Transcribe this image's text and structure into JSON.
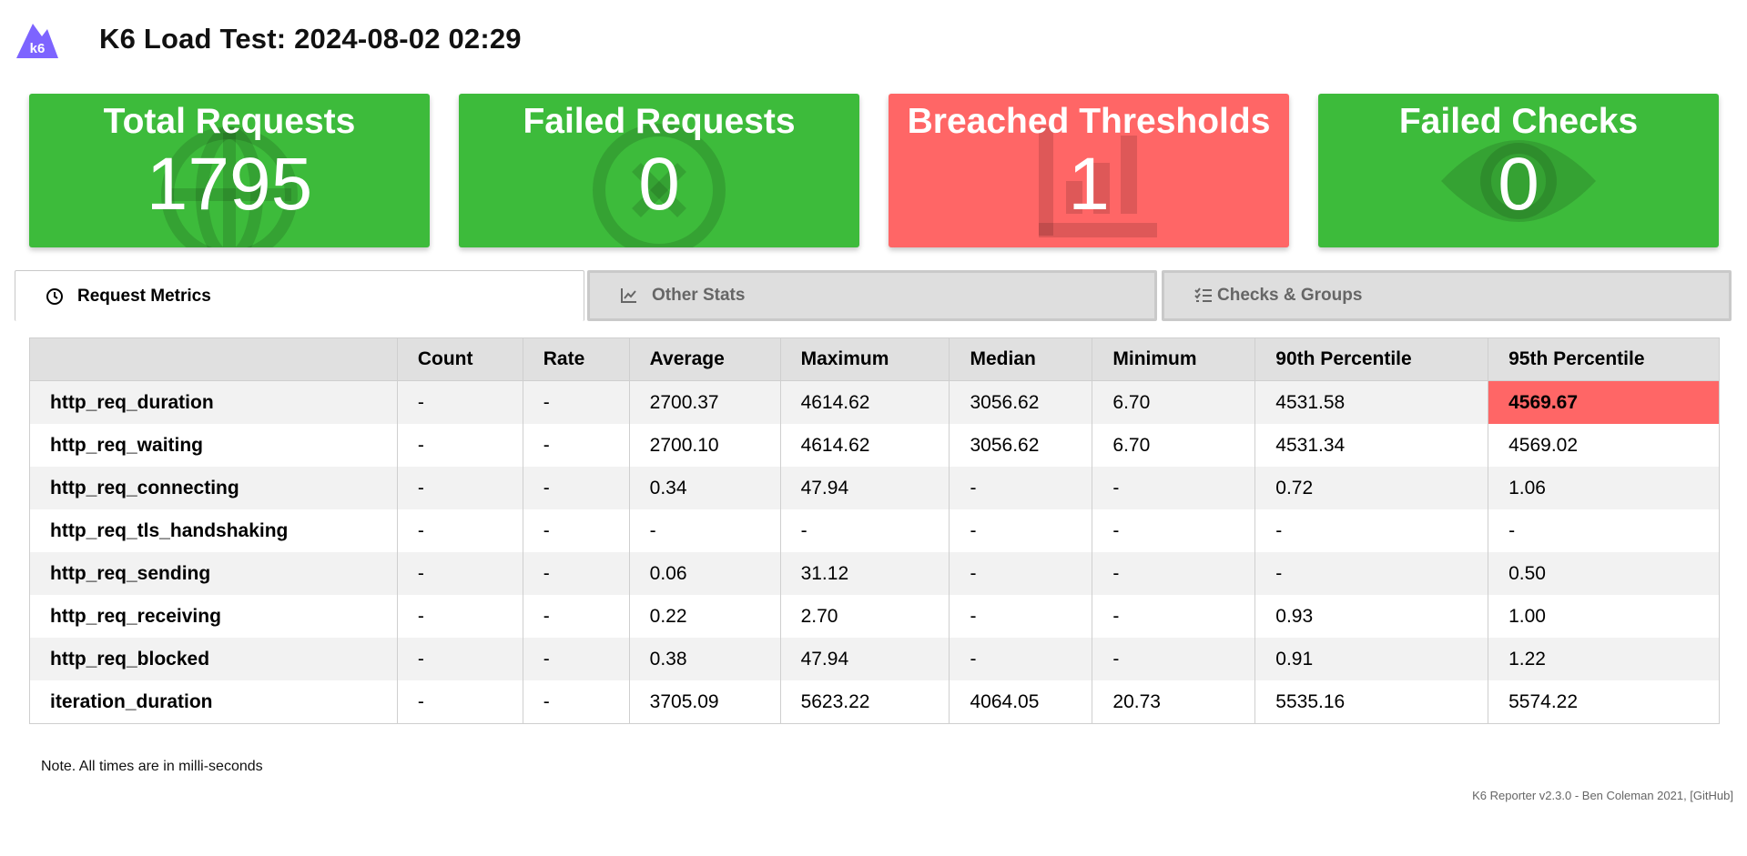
{
  "header": {
    "logo_text": "k6",
    "title": "K6 Load Test: 2024-08-02 02:29"
  },
  "cards": [
    {
      "label": "Total Requests",
      "value": "1795",
      "status": "ok",
      "color": "#3dbb3b",
      "icon": "globe-icon"
    },
    {
      "label": "Failed Requests",
      "value": "0",
      "status": "ok",
      "color": "#3dbb3b",
      "icon": "close-circle-icon"
    },
    {
      "label": "Breached Thresholds",
      "value": "1",
      "status": "breached",
      "color": "#ff6666",
      "icon": "bar-chart-icon"
    },
    {
      "label": "Failed Checks",
      "value": "0",
      "status": "ok",
      "color": "#3dbb3b",
      "icon": "eye-icon"
    }
  ],
  "tabs": [
    {
      "label": "Request Metrics",
      "icon": "clock-icon",
      "active": true
    },
    {
      "label": "Other Stats",
      "icon": "line-chart-icon",
      "active": false
    },
    {
      "label": "Checks & Groups",
      "icon": "checklist-icon",
      "active": false
    }
  ],
  "table": {
    "columns": [
      "",
      "Count",
      "Rate",
      "Average",
      "Maximum",
      "Median",
      "Minimum",
      "90th Percentile",
      "95th Percentile"
    ],
    "rows": [
      {
        "name": "http_req_duration",
        "count": "-",
        "rate": "-",
        "avg": "2700.37",
        "max": "4614.62",
        "median": "3056.62",
        "min": "6.70",
        "p90": "4531.58",
        "p95": "4569.67",
        "p95_breached": true
      },
      {
        "name": "http_req_waiting",
        "count": "-",
        "rate": "-",
        "avg": "2700.10",
        "max": "4614.62",
        "median": "3056.62",
        "min": "6.70",
        "p90": "4531.34",
        "p95": "4569.02",
        "p95_breached": false
      },
      {
        "name": "http_req_connecting",
        "count": "-",
        "rate": "-",
        "avg": "0.34",
        "max": "47.94",
        "median": "-",
        "min": "-",
        "p90": "0.72",
        "p95": "1.06",
        "p95_breached": false
      },
      {
        "name": "http_req_tls_handshaking",
        "count": "-",
        "rate": "-",
        "avg": "-",
        "max": "-",
        "median": "-",
        "min": "-",
        "p90": "-",
        "p95": "-",
        "p95_breached": false
      },
      {
        "name": "http_req_sending",
        "count": "-",
        "rate": "-",
        "avg": "0.06",
        "max": "31.12",
        "median": "-",
        "min": "-",
        "p90": "-",
        "p95": "0.50",
        "p95_breached": false
      },
      {
        "name": "http_req_receiving",
        "count": "-",
        "rate": "-",
        "avg": "0.22",
        "max": "2.70",
        "median": "-",
        "min": "-",
        "p90": "0.93",
        "p95": "1.00",
        "p95_breached": false
      },
      {
        "name": "http_req_blocked",
        "count": "-",
        "rate": "-",
        "avg": "0.38",
        "max": "47.94",
        "median": "-",
        "min": "-",
        "p90": "0.91",
        "p95": "1.22",
        "p95_breached": false
      },
      {
        "name": "iteration_duration",
        "count": "-",
        "rate": "-",
        "avg": "3705.09",
        "max": "5623.22",
        "median": "4064.05",
        "min": "20.73",
        "p90": "5535.16",
        "p95": "5574.22",
        "p95_breached": false
      }
    ]
  },
  "note": "Note. All times are in milli-seconds",
  "footer": "K6 Reporter v2.3.0 - Ben Coleman 2021, [GitHub]",
  "colors": {
    "ok": "#3dbb3b",
    "breached": "#ff6666",
    "brand": "#7d64ff"
  }
}
